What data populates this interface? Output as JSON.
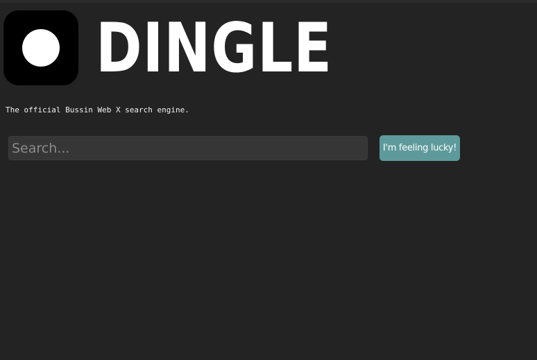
{
  "header": {
    "logo_icon": "circle-logo-icon",
    "title": "DINGLE"
  },
  "tagline": "The official Bussin Web X search engine.",
  "search": {
    "placeholder": "Search...",
    "value": ""
  },
  "lucky_button": {
    "label": "I'm feeling lucky!"
  },
  "colors": {
    "background": "#232323",
    "input_background": "#363636",
    "button_accent": "#5e9a9c",
    "logo_background": "#000000",
    "text": "#ffffff"
  }
}
